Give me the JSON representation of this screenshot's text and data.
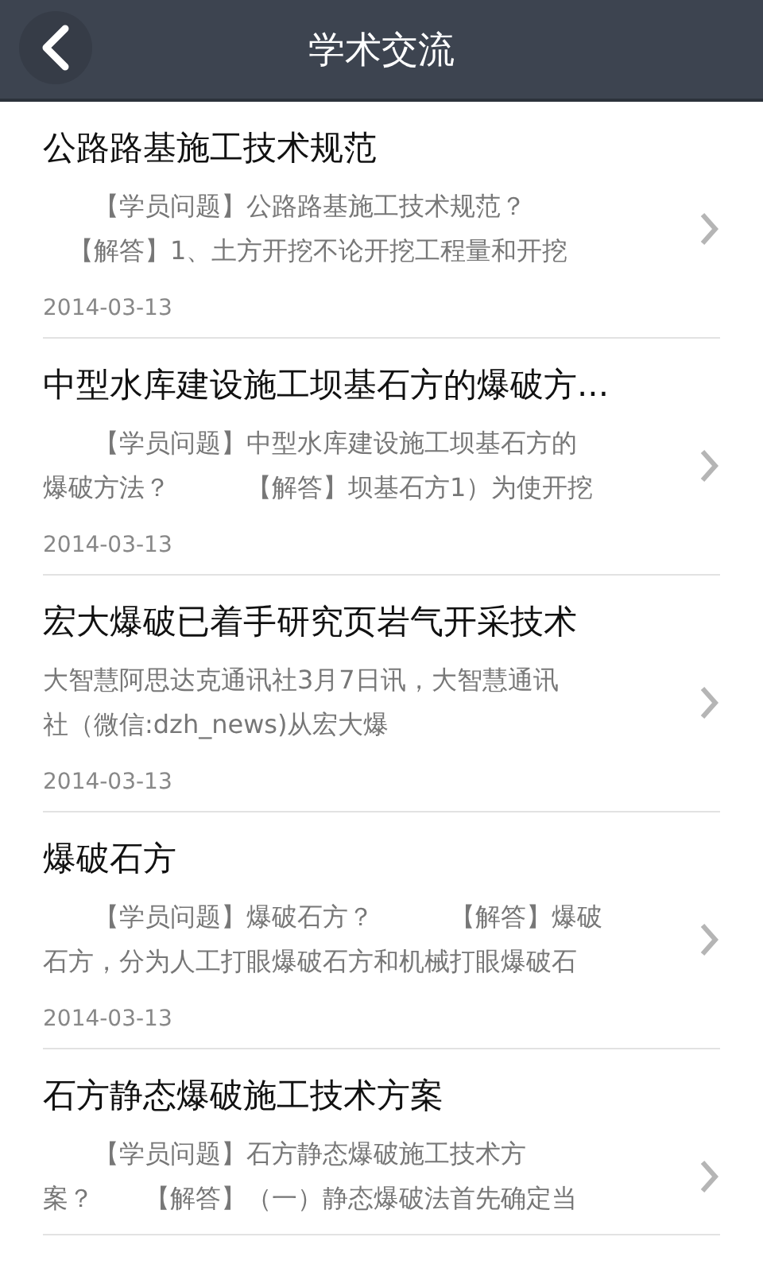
{
  "header": {
    "title": "学术交流"
  },
  "articles": [
    {
      "title": "公路路基施工技术规范",
      "summary_lines": [
        "　　【学员问题】公路路基施工技术规范？",
        "　【解答】1、土方开挖不论开挖工程量和开挖"
      ],
      "date": "2014-03-13"
    },
    {
      "title": "中型水库建设施工坝基石方的爆破方...",
      "summary_lines": [
        "　　【学员问题】中型水库建设施工坝基石方的",
        "爆破方法？　　　【解答】坝基石方1）为使开挖"
      ],
      "date": "2014-03-13"
    },
    {
      "title": "宏大爆破已着手研究页岩气开采技术",
      "summary_lines": [
        "大智慧阿思达克通讯社3月7日讯，大智慧通讯",
        "社（微信:dzh_news)从宏大爆"
      ],
      "date": "2014-03-13"
    },
    {
      "title": "爆破石方",
      "summary_lines": [
        "　　【学员问题】爆破石方？　　　【解答】爆破",
        "石方，分为人工打眼爆破石方和机械打眼爆破石"
      ],
      "date": "2014-03-13"
    },
    {
      "title": "石方静态爆破施工技术方案",
      "summary_lines": [
        "　　【学员问题】石方静态爆破施工技术方",
        "案？　　【解答】（一）静态爆破法首先确定当"
      ]
    }
  ]
}
